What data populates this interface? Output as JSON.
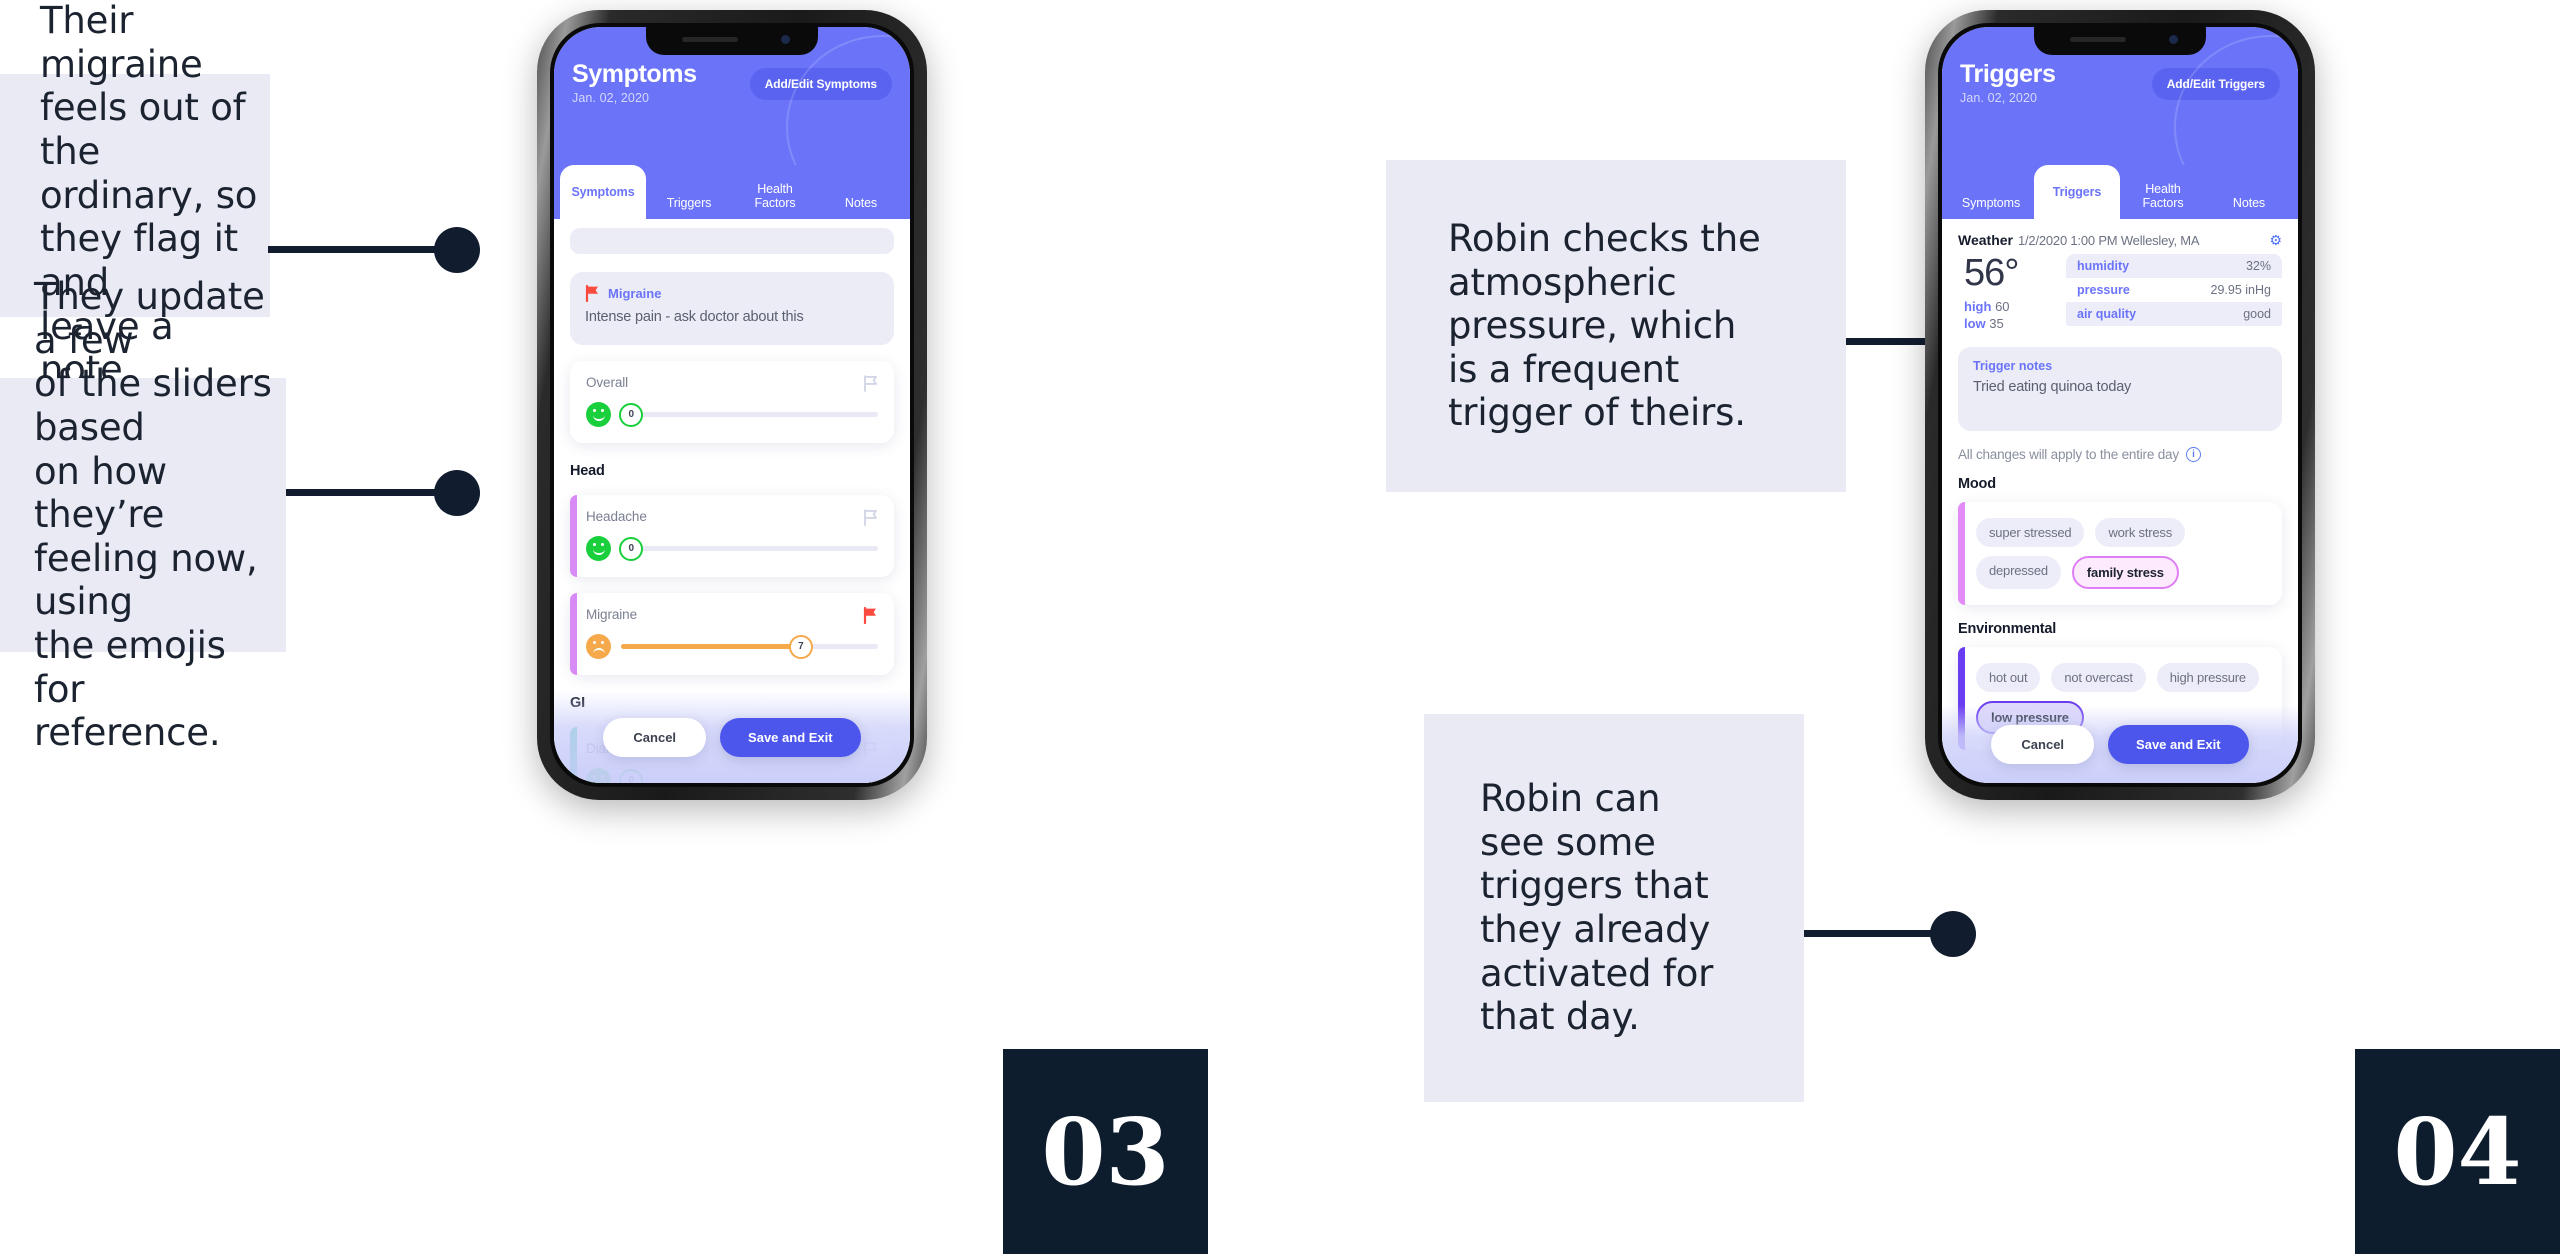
{
  "callouts": [
    {
      "id": "callout-1",
      "text": "Their migraine\nfeels out of the\nordinary, so\nthey flag it and\nleave a note."
    },
    {
      "id": "callout-2",
      "text": "They update a few\nof the sliders based\non how they’re\nfeeling now, using\nthe emojis for\nreference."
    },
    {
      "id": "callout-3",
      "text": "Robin checks the\natmospheric\npressure, which\nis a frequent\ntrigger of theirs."
    },
    {
      "id": "callout-4",
      "text": "Robin can\nsee some\ntriggers that\nthey already\nactivated for\nthat day."
    }
  ],
  "badges": [
    {
      "id": "badge-03",
      "label": "03"
    },
    {
      "id": "badge-04",
      "label": "04"
    }
  ],
  "phone_symptoms": {
    "header": {
      "title": "Symptoms",
      "date": "Jan. 02, 2020",
      "action_label": "Add/Edit Symptoms"
    },
    "tabs": [
      {
        "label": "Symptoms",
        "active": true
      },
      {
        "label": "Triggers",
        "active": false
      },
      {
        "label": "Health\nFactors",
        "active": false
      },
      {
        "label": "Notes",
        "active": false
      }
    ],
    "note_card": {
      "flag_icon": "flag-red-icon",
      "title": "Migraine",
      "body": "Intense pain - ask doctor about this"
    },
    "overall": {
      "label": "Overall",
      "flag_icon": "flag-outline-icon",
      "emoji": "smiley-happy-icon",
      "value": "0",
      "fill_percent": 0
    },
    "sections": [
      {
        "title": "Head",
        "items": [
          {
            "label": "Headache",
            "flag_icon": "flag-outline-icon",
            "emoji": "smiley-happy-icon",
            "value": "0",
            "fill_percent": 0,
            "accent": "#d98bf5"
          },
          {
            "label": "Migraine",
            "flag_icon": "flag-red-icon",
            "emoji": "smiley-sad-icon",
            "value": "7",
            "fill_percent": 70,
            "accent": "#d98bf5"
          }
        ]
      },
      {
        "title": "GI",
        "items": [
          {
            "label": "Diarrhea",
            "flag_icon": "flag-outline-icon",
            "emoji": "smiley-happy-icon",
            "value": "0",
            "fill_percent": 0,
            "accent": "#13c296"
          }
        ]
      }
    ],
    "actions": {
      "cancel_label": "Cancel",
      "save_label": "Save and Exit"
    }
  },
  "phone_triggers": {
    "header": {
      "title": "Triggers",
      "date": "Jan. 02, 2020",
      "action_label": "Add/Edit Triggers"
    },
    "tabs": [
      {
        "label": "Symptoms",
        "active": false
      },
      {
        "label": "Triggers",
        "active": true
      },
      {
        "label": "Health\nFactors",
        "active": false
      },
      {
        "label": "Notes",
        "active": false
      }
    ],
    "weather": {
      "word": "Weather",
      "meta": "1/2/2020 1:00 PM Wellesley, MA",
      "gear_icon": "gear-icon",
      "temperature": "56",
      "unit": "°",
      "high_label": "high",
      "high_value": "60",
      "low_label": "low",
      "low_value": "35",
      "rows": [
        {
          "key": "humidity",
          "value": "32%"
        },
        {
          "key": "pressure",
          "value": "29.95 inHg"
        },
        {
          "key": "air quality",
          "value": "good"
        }
      ]
    },
    "trigger_notes": {
      "title": "Trigger notes",
      "body": "Tried eating quinoa today"
    },
    "info_line": {
      "text": "All changes will apply to the entire day",
      "icon": "info-circle-icon"
    },
    "groups": [
      {
        "title": "Mood",
        "accent": "#e38cf8",
        "tags": [
          {
            "label": "super stressed",
            "selected": false
          },
          {
            "label": "work stress",
            "selected": false
          },
          {
            "label": "depressed",
            "selected": false
          },
          {
            "label": "family stress",
            "selected": true
          }
        ]
      },
      {
        "title": "Environmental",
        "accent": "#6b3df0",
        "tags": [
          {
            "label": "hot out",
            "selected": false
          },
          {
            "label": "not overcast",
            "selected": false
          },
          {
            "label": "high pressure",
            "selected": false
          },
          {
            "label": "low pressure",
            "selected": true
          }
        ]
      }
    ],
    "actions": {
      "cancel_label": "Cancel",
      "save_label": "Save and Exit"
    }
  }
}
